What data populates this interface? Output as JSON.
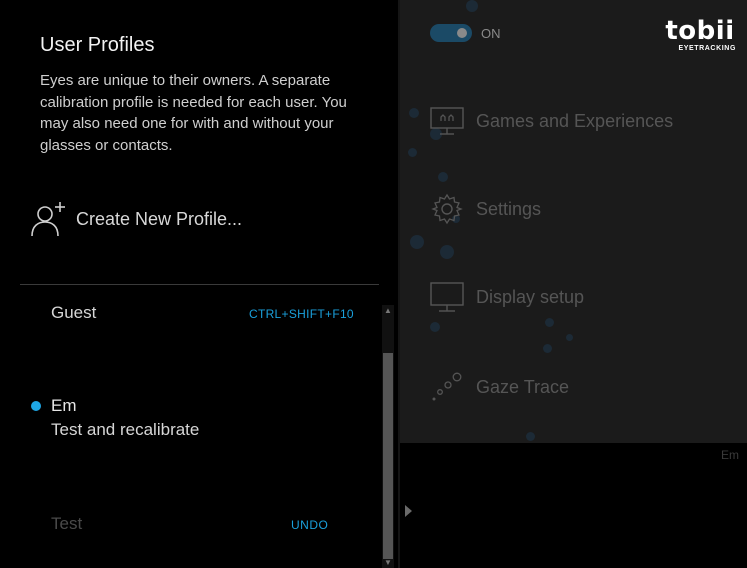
{
  "profiles_panel": {
    "title": "User Profiles",
    "description": "Eyes are unique to their owners. A separate calibration profile is needed for each user. You may also need one for with and without your glasses or contacts.",
    "create_label": "Create New Profile...",
    "profiles": [
      {
        "name": "Guest",
        "shortcut": "CTRL+SHIFT+F10"
      },
      {
        "name": "Em",
        "action": "Test and recalibrate",
        "active": true
      },
      {
        "name": "Test",
        "action": "UNDO",
        "deleted": true
      }
    ]
  },
  "app": {
    "toggle_label": "ON",
    "toggle_on": true,
    "logo": {
      "word": "tobii",
      "sub": "EYETRACKING"
    },
    "menu": [
      {
        "label": "Games and Experiences",
        "icon": "games-monitor-icon"
      },
      {
        "label": "Settings",
        "icon": "gear-icon"
      },
      {
        "label": "Display setup",
        "icon": "monitor-icon"
      },
      {
        "label": "Gaze Trace",
        "icon": "gaze-trace-icon"
      }
    ],
    "current_user": "Em"
  },
  "colors": {
    "accent": "#1aa0dc",
    "active_dot": "#1ea7e6",
    "background": "#000000",
    "dimmed_panel": "#1b1b1b"
  }
}
